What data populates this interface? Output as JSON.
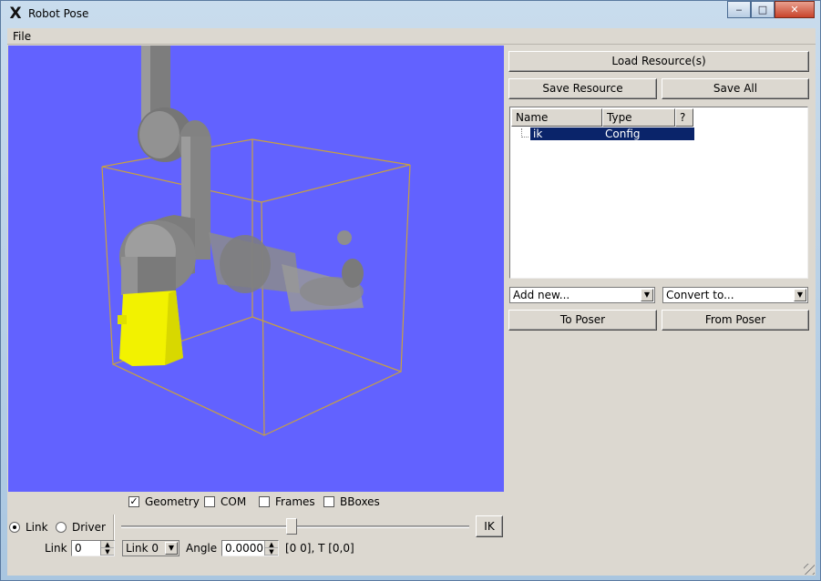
{
  "window": {
    "title": "Robot Pose",
    "buttons": {
      "minimize": "‒",
      "maximize": "□",
      "close": "✕"
    }
  },
  "menu": {
    "file": "File"
  },
  "view_options": {
    "geometry": {
      "label": "Geometry",
      "checked": true
    },
    "com": {
      "label": "COM",
      "checked": false
    },
    "frames": {
      "label": "Frames",
      "checked": false
    },
    "bboxes": {
      "label": "BBoxes",
      "checked": false
    }
  },
  "mode": {
    "link_label": "Link",
    "driver_label": "Driver",
    "selected": "Link"
  },
  "ik_button": "IK",
  "slider": {
    "value_fraction": 0.49
  },
  "link_row": {
    "link_label": "Link",
    "link_index": "0",
    "link_select": "Link 0",
    "angle_label": "Angle",
    "angle_value": "0.0000",
    "info": "[0 0], T [0,0]"
  },
  "resources": {
    "load": "Load Resource(s)",
    "save": "Save Resource",
    "save_all": "Save All",
    "columns": {
      "name": "Name",
      "type": "Type",
      "extra": "?"
    },
    "items": [
      {
        "name": "ik",
        "type": "Config"
      }
    ],
    "add_new": "Add new...",
    "convert_to": "Convert to...",
    "to_poser": "To Poser",
    "from_poser": "From Poser"
  },
  "colors": {
    "viewport_bg": "#6262ff",
    "robot_gray": "#8a8a8a",
    "base_yellow": "#f2f200",
    "bbox_line": "#c8a040",
    "selection": "#0a246a"
  }
}
